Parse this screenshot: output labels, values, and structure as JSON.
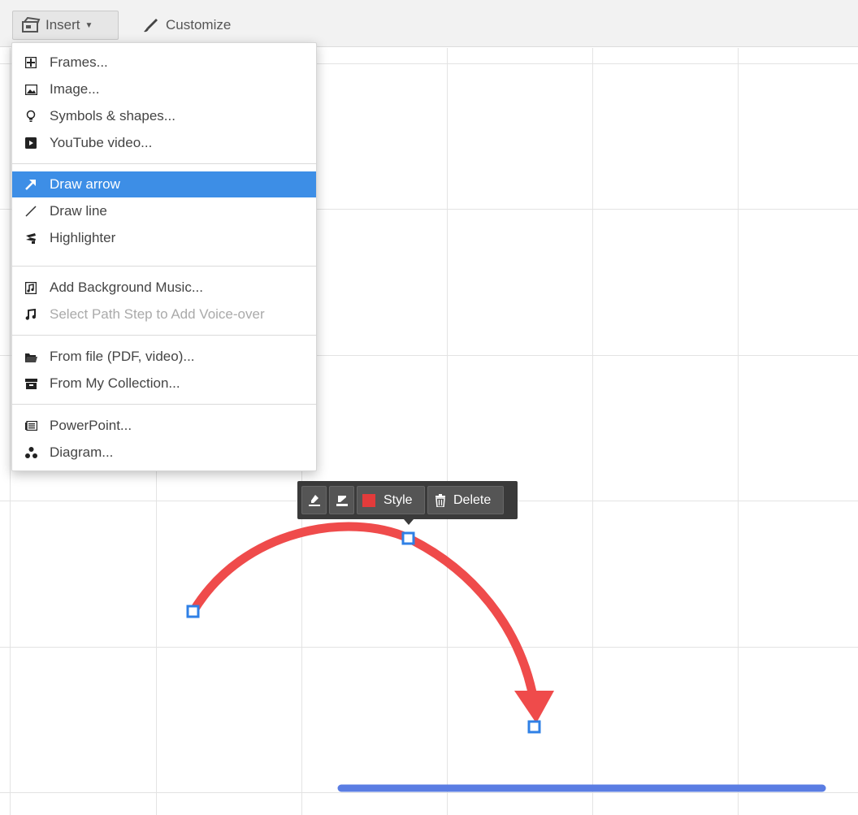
{
  "toolbar": {
    "insert_label": "Insert",
    "customize_label": "Customize"
  },
  "menu": {
    "items": [
      {
        "label": "Frames...",
        "icon": "frames-icon"
      },
      {
        "label": "Image...",
        "icon": "image-icon"
      },
      {
        "label": "Symbols & shapes...",
        "icon": "lightbulb-icon"
      },
      {
        "label": "YouTube video...",
        "icon": "youtube-icon"
      },
      {
        "label": "Draw arrow",
        "icon": "arrow-icon",
        "active": true
      },
      {
        "label": "Draw line",
        "icon": "line-icon"
      },
      {
        "label": "Highlighter",
        "icon": "highlighter-icon"
      },
      {
        "label": "Add Background Music...",
        "icon": "music-file-icon"
      },
      {
        "label": "Select Path Step to Add Voice-over",
        "icon": "music-note-icon",
        "disabled": true
      },
      {
        "label": "From file (PDF, video)...",
        "icon": "folder-icon"
      },
      {
        "label": "From My Collection...",
        "icon": "archive-icon"
      },
      {
        "label": "PowerPoint...",
        "icon": "powerpoint-icon"
      },
      {
        "label": "Diagram...",
        "icon": "diagram-icon"
      }
    ]
  },
  "floating_toolbar": {
    "style_label": "Style",
    "delete_label": "Delete"
  },
  "colors": {
    "accent": "#3d8ee6",
    "arrow": "#ef4b4b",
    "highlighter_line": "#5a7de3",
    "handle": "#2f80e6"
  }
}
